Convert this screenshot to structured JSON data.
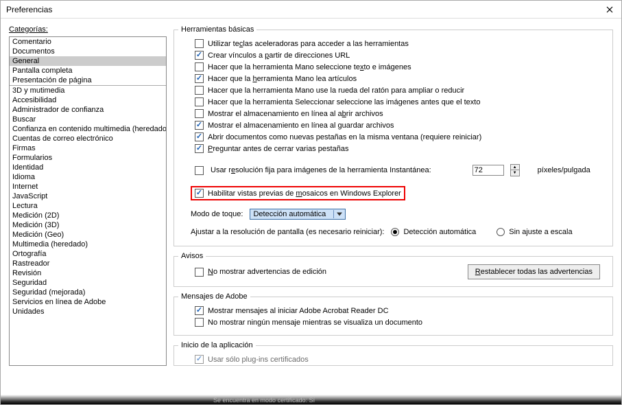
{
  "window": {
    "title": "Preferencias"
  },
  "sidebar": {
    "label": "Categorías:",
    "group1": [
      "Comentario",
      "Documentos",
      "General",
      "Pantalla completa",
      "Presentación de página"
    ],
    "selected": "General",
    "group2": [
      "3D y mutimedia",
      "Accesibilidad",
      "Administrador de confianza",
      "Buscar",
      "Confianza en contenido multimedia (heredado)",
      "Cuentas de correo electrónico",
      "Firmas",
      "Formularios",
      "Identidad",
      "Idioma",
      "Internet",
      "JavaScript",
      "Lectura",
      "Medición (2D)",
      "Medición (3D)",
      "Medición (Geo)",
      "Multimedia (heredado)",
      "Ortografía",
      "Rastreador",
      "Revisión",
      "Seguridad",
      "Seguridad (mejorada)",
      "Servicios en línea de Adobe",
      "Unidades"
    ]
  },
  "basic": {
    "legend": "Herramientas básicas",
    "items": [
      {
        "checked": false,
        "pre": "Utilizar te",
        "u": "c",
        "post": "las aceleradoras para acceder a las herramientas"
      },
      {
        "checked": true,
        "pre": "Crear vínculos a ",
        "u": "p",
        "post": "artir de direcciones URL"
      },
      {
        "checked": false,
        "pre": "Hacer que la herramienta Mano seleccione te",
        "u": "x",
        "post": "to e imágenes"
      },
      {
        "checked": true,
        "pre": "Hacer que la ",
        "u": "h",
        "post": "erramienta Mano lea artículos"
      },
      {
        "checked": false,
        "text": "Hacer que la herramienta Mano use la rueda del ratón para ampliar o reducir"
      },
      {
        "checked": false,
        "text": "Hacer que la herramienta Seleccionar seleccione las imágenes antes que el texto"
      },
      {
        "checked": false,
        "pre": "Mostrar el almacenamiento en línea al a",
        "u": "b",
        "post": "rir archivos"
      },
      {
        "checked": true,
        "pre": "Mostrar el almacenamiento en línea al ",
        "u": "g",
        "post": "uardar archivos"
      },
      {
        "checked": true,
        "text": "Abrir documentos como nuevas pestañas en la misma ventana (requiere reiniciar)"
      },
      {
        "checked": true,
        "pre": "",
        "u": "P",
        "post": "reguntar antes de cerrar varias pestañas"
      }
    ],
    "res": {
      "checked": false,
      "pre": "Usar r",
      "u": "e",
      "post": "solución fija para imágenes de la herramienta Instantánea:",
      "value": "72",
      "unit": "píxeles/pulgada"
    },
    "thumb": {
      "checked": true,
      "pre": "Habilitar vistas previas de ",
      "u": "m",
      "post": "osaicos en Windows Explorer"
    },
    "touch": {
      "label": "Modo de toque:",
      "value": "Detección automática"
    },
    "scale": {
      "label": "Ajustar a la resolución de pantalla (es necesario reiniciar):",
      "opt1": "Detección automática",
      "opt2": "Sin ajuste a escala",
      "selected": "opt1"
    }
  },
  "avisos": {
    "legend": "Avisos",
    "chk": {
      "checked": false,
      "pre": "",
      "u": "N",
      "post": "o mostrar advertencias de edición"
    },
    "btn": {
      "pre": "",
      "u": "R",
      "post": "establecer todas las advertencias"
    }
  },
  "adobe": {
    "legend": "Mensajes de Adobe",
    "items": [
      {
        "checked": true,
        "text": "Mostrar mensajes al iniciar Adobe Acrobat Reader DC"
      },
      {
        "checked": false,
        "text": "No mostrar ningún mensaje mientras se visualiza un documento"
      }
    ]
  },
  "startup": {
    "legend": "Inicio de la aplicación",
    "partial": {
      "checked": true,
      "text": "Usar sólo plug-ins certificados"
    },
    "status": "Se encuentra en modo certificado:   Sí"
  }
}
